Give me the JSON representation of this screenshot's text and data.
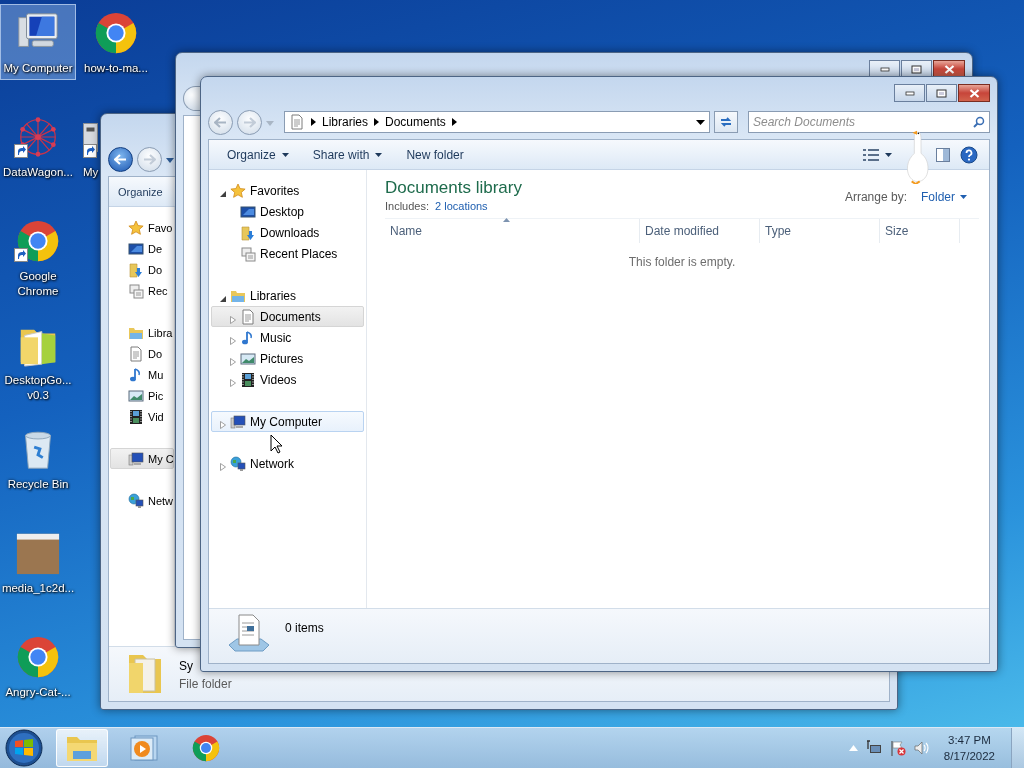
{
  "desktop_icons": [
    {
      "kind": "computer",
      "label": "My Computer",
      "selected": true,
      "shortcut": false
    },
    {
      "kind": "browser",
      "label": "how-to-ma...",
      "selected": false,
      "shortcut": false
    },
    {
      "kind": "graph",
      "label": "DataWagon...",
      "selected": false,
      "shortcut": true
    },
    {
      "kind": "app",
      "label": "My",
      "selected": false,
      "shortcut": true
    },
    {
      "kind": "browser",
      "label": "Google Chrome",
      "selected": false,
      "shortcut": true
    },
    {
      "kind": "folder",
      "label": "DesktopGo... v0.3",
      "selected": false,
      "shortcut": false
    },
    {
      "kind": "bin",
      "label": "Recycle Bin",
      "selected": false,
      "shortcut": false
    },
    {
      "kind": "photo",
      "label": "media_1c2d...",
      "selected": false,
      "shortcut": false
    },
    {
      "kind": "browser",
      "label": "Angry-Cat-...",
      "selected": false,
      "shortcut": false
    }
  ],
  "back_window": {
    "toolbar": [
      {
        "label": "Organize"
      }
    ],
    "nav": [
      {
        "label": "Favo",
        "kind": "star",
        "selected": false,
        "hovered": false,
        "children": [
          {
            "label": "De",
            "kind": "desktop",
            "selected": false,
            "hovered": false
          },
          {
            "label": "Do",
            "kind": "downloads",
            "selected": false,
            "hovered": false
          },
          {
            "label": "Rec",
            "kind": "recent",
            "selected": false,
            "hovered": false
          }
        ]
      },
      {
        "label": "Libra",
        "kind": "libraries",
        "selected": false,
        "hovered": false,
        "children": [
          {
            "label": "Do",
            "kind": "document",
            "selected": false,
            "hovered": false
          },
          {
            "label": "Mu",
            "kind": "music",
            "selected": false,
            "hovered": false
          },
          {
            "label": "Pic",
            "kind": "pictures",
            "selected": false,
            "hovered": false
          },
          {
            "label": "Vid",
            "kind": "videos",
            "selected": false,
            "hovered": false
          }
        ]
      },
      {
        "label": "My C",
        "kind": "computer",
        "selected": true,
        "hovered": false
      },
      {
        "label": "Netw",
        "kind": "network",
        "selected": false,
        "hovered": false
      }
    ],
    "details": {
      "name": "Sy",
      "type": "File folder"
    }
  },
  "front_window": {
    "address_path": [
      "Libraries",
      "Documents"
    ],
    "search": {
      "placeholder": "Search Documents"
    },
    "toolbar": [
      {
        "label": "Organize",
        "dropdown": true
      },
      {
        "label": "Share with",
        "dropdown": true
      },
      {
        "label": "New folder",
        "dropdown": false
      }
    ],
    "nav": [
      {
        "label": "Favorites",
        "kind": "star",
        "expanded": true,
        "selected": false,
        "hovered": false,
        "children": [
          {
            "label": "Desktop",
            "kind": "desktop",
            "selected": false,
            "hovered": false
          },
          {
            "label": "Downloads",
            "kind": "downloads",
            "selected": false,
            "hovered": false
          },
          {
            "label": "Recent Places",
            "kind": "recent",
            "selected": false,
            "hovered": false
          }
        ]
      },
      {
        "label": "Libraries",
        "kind": "libraries",
        "expanded": true,
        "selected": false,
        "hovered": false,
        "children": [
          {
            "label": "Documents",
            "kind": "document",
            "expanded": false,
            "selected": true,
            "hovered": false
          },
          {
            "label": "Music",
            "kind": "music",
            "expanded": false,
            "selected": false,
            "hovered": false
          },
          {
            "label": "Pictures",
            "kind": "pictures",
            "expanded": false,
            "selected": false,
            "hovered": false
          },
          {
            "label": "Videos",
            "kind": "videos",
            "expanded": false,
            "selected": false,
            "hovered": false
          }
        ]
      },
      {
        "label": "My Computer",
        "kind": "computer",
        "expanded": false,
        "selected": false,
        "hovered": true
      },
      {
        "label": "Network",
        "kind": "network",
        "expanded": false,
        "selected": false,
        "hovered": false
      }
    ],
    "library": {
      "title": "Documents library",
      "includes_label": "Includes:",
      "includes_link": "2 locations",
      "arrange_label": "Arrange by:",
      "arrange_value": "Folder"
    },
    "columns": [
      {
        "label": "Name",
        "sorted": true
      },
      {
        "label": "Date modified",
        "sorted": false
      },
      {
        "label": "Type",
        "sorted": false
      },
      {
        "label": "Size",
        "sorted": false
      }
    ],
    "empty_message": "This folder is empty.",
    "status": "0 items"
  },
  "taskbar": {
    "buttons": [
      {
        "kind": "explorer",
        "active": true
      },
      {
        "kind": "media",
        "active": false
      },
      {
        "kind": "browser",
        "active": false
      }
    ],
    "clock": {
      "time": "3:47 PM",
      "date": "8/17/2022"
    }
  }
}
